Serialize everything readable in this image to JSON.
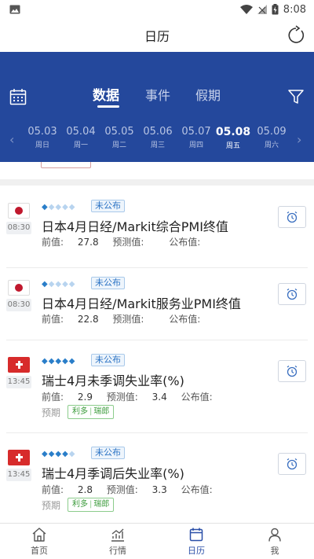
{
  "status": {
    "time": "8:08"
  },
  "header": {
    "title": "日历"
  },
  "tabs": [
    {
      "label": "数据",
      "active": true
    },
    {
      "label": "事件",
      "active": false
    },
    {
      "label": "假期",
      "active": false
    }
  ],
  "dates": [
    {
      "date": "05.03",
      "weekday": "周日",
      "active": false
    },
    {
      "date": "05.04",
      "weekday": "周一",
      "active": false
    },
    {
      "date": "05.05",
      "weekday": "周二",
      "active": false
    },
    {
      "date": "05.06",
      "weekday": "周三",
      "active": false
    },
    {
      "date": "05.07",
      "weekday": "周四",
      "active": false
    },
    {
      "date": "05.08",
      "weekday": "周五",
      "active": true
    },
    {
      "date": "05.09",
      "weekday": "周六",
      "active": false
    }
  ],
  "events": [
    {
      "country": "Japan",
      "time": "08:30",
      "importance": 1,
      "status": "未公布",
      "title": "日本4月日经/Markit综合PMI终值",
      "previous_label": "前值:",
      "previous": "27.8",
      "forecast_label": "预测值:",
      "forecast": "",
      "actual_label": "公布值:",
      "actual": ""
    },
    {
      "country": "Japan",
      "time": "08:30",
      "importance": 1,
      "status": "未公布",
      "title": "日本4月日经/Markit服务业PMI终值",
      "previous_label": "前值:",
      "previous": "22.8",
      "forecast_label": "预测值:",
      "forecast": "",
      "actual_label": "公布值:",
      "actual": ""
    },
    {
      "country": "Switzerland",
      "time": "13:45",
      "importance": 5,
      "status": "未公布",
      "title": "瑞士4月未季调失业率(%)",
      "previous_label": "前值:",
      "previous": "2.9",
      "forecast_label": "预测值:",
      "forecast": "3.4",
      "actual_label": "公布值:",
      "actual": "",
      "expect_label": "预期",
      "expect_effect": "利多",
      "expect_currency": "瑞郎"
    },
    {
      "country": "Switzerland",
      "time": "13:45",
      "importance": 4,
      "status": "未公布",
      "title": "瑞士4月季调后失业率(%)",
      "previous_label": "前值:",
      "previous": "2.8",
      "forecast_label": "预测值:",
      "forecast": "3.3",
      "actual_label": "公布值:",
      "actual": "",
      "expect_label": "预期",
      "expect_effect": "利多",
      "expect_currency": "瑞郎"
    }
  ],
  "bottom_nav": [
    {
      "label": "首页",
      "icon": "home-icon",
      "active": false
    },
    {
      "label": "行情",
      "icon": "chart-icon",
      "active": false
    },
    {
      "label": "日历",
      "icon": "calendar-icon",
      "active": true
    },
    {
      "label": "我",
      "icon": "user-icon",
      "active": false
    }
  ],
  "colors": {
    "accent": "#24489c",
    "star_on": "#2a7ec9",
    "star_off": "#b8d4ef",
    "positive": "#3a9a3a"
  }
}
